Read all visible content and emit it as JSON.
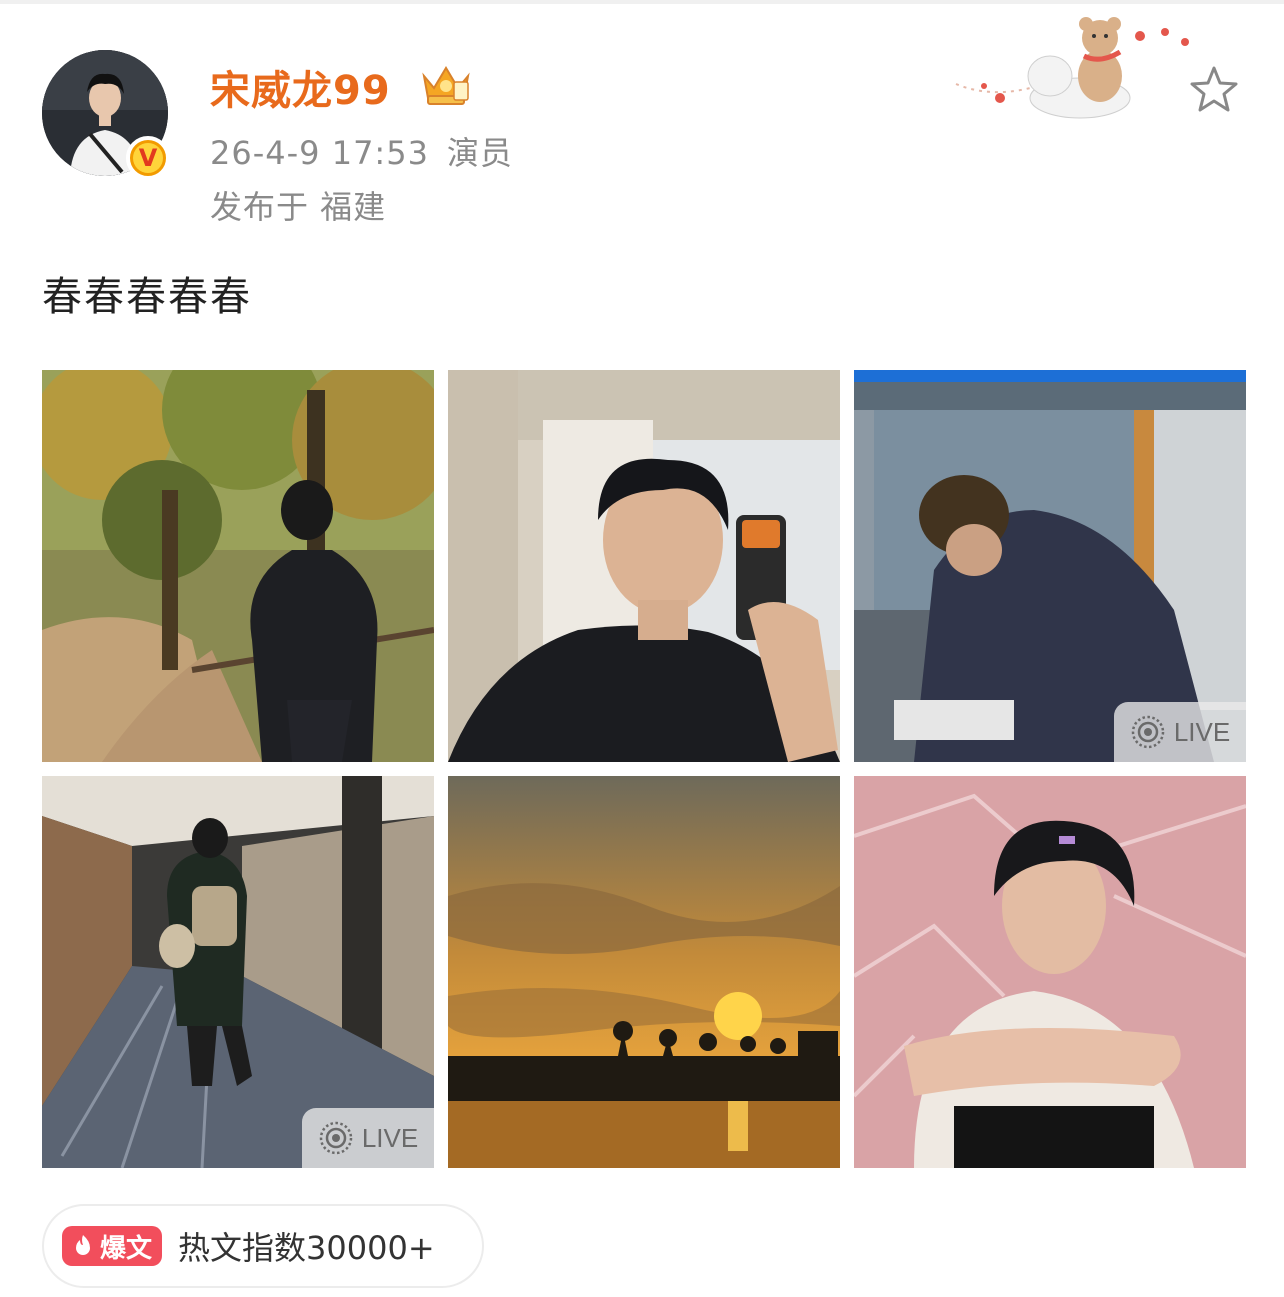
{
  "header": {
    "username": "宋威龙99",
    "time": "26-4-9 17:53",
    "role": "演员",
    "location": "发布于 福建",
    "verified_badge": "V"
  },
  "post": {
    "text": "春春春春春"
  },
  "photos": [
    {
      "name": "forest-path-photo",
      "live": false
    },
    {
      "name": "mirror-selfie-photo",
      "live": false
    },
    {
      "name": "window-reflection-photo",
      "live": true
    },
    {
      "name": "hotel-corridor-photo",
      "live": true
    },
    {
      "name": "sunset-lake-photo",
      "live": false
    },
    {
      "name": "pink-plastic-portrait-photo",
      "live": false
    }
  ],
  "live_label": "LIVE",
  "hot": {
    "badge": "爆文",
    "text": "热文指数30000+"
  },
  "icons": {
    "crown": "crown-badge-icon",
    "star": "star-icon",
    "live": "live-icon",
    "fire": "fire-icon"
  },
  "colors": {
    "username": "#e86a1c",
    "meta": "#8a8a8a",
    "hot_badge": "#f24e5c",
    "verified": "#f29b00"
  }
}
